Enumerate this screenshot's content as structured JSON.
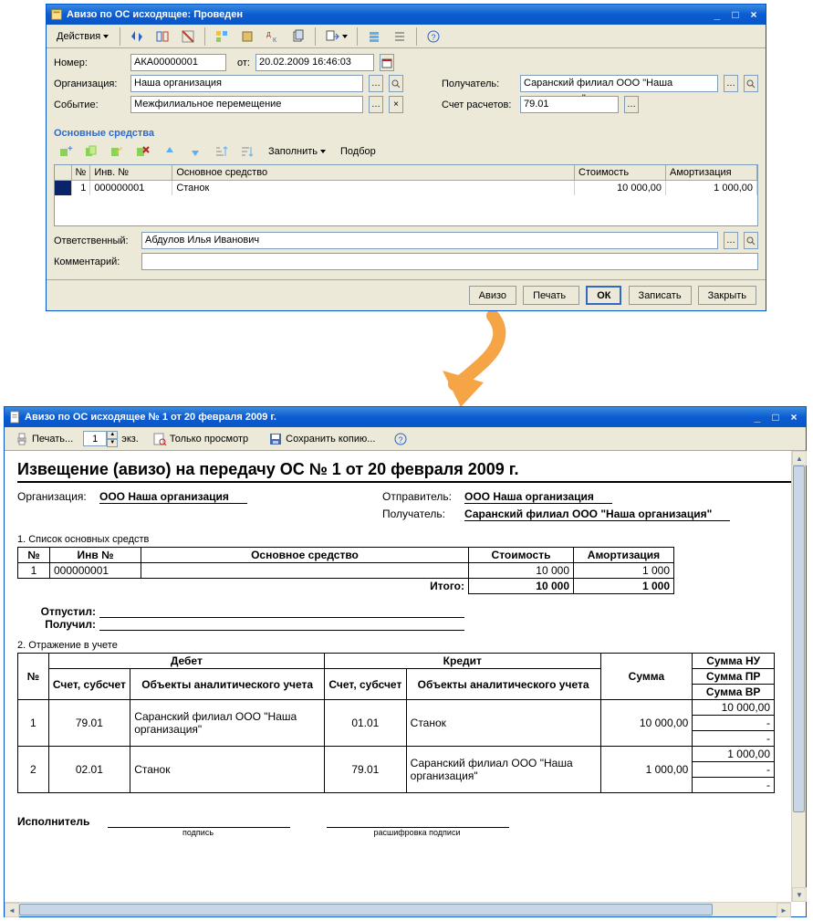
{
  "window1": {
    "title": "Авизо по ОС исходящее: Проведен",
    "toolbar": {
      "actions_label": "Действия"
    },
    "form": {
      "number_label": "Номер:",
      "number_value": "АКА00000001",
      "from_label": "от:",
      "date_value": "20.02.2009 16:46:03",
      "org_label": "Организация:",
      "org_value": "Наша организация",
      "event_label": "Событие:",
      "event_value": "Межфилиальное перемещение",
      "recipient_label": "Получатель:",
      "recipient_value": "Саранский филиал ООО \"Наша организация\"",
      "account_label": "Счет расчетов:",
      "account_value": "79.01"
    },
    "section_title": "Основные средства",
    "subtoolbar": {
      "fill": "Заполнить",
      "pick": "Подбор"
    },
    "grid": {
      "headers": {
        "n": "№",
        "inv": "Инв. №",
        "asset": "Основное средство",
        "cost": "Стоимость",
        "amort": "Амортизация"
      },
      "row": {
        "n": "1",
        "inv": "000000001",
        "asset": "Станок",
        "cost": "10 000,00",
        "amort": "1 000,00"
      }
    },
    "resp_label": "Ответственный:",
    "resp_value": "Абдулов Илья Иванович",
    "comment_label": "Комментарий:",
    "bottom": {
      "avizo": "Авизо",
      "print": "Печать",
      "ok": "ОК",
      "save": "Записать",
      "close": "Закрыть"
    }
  },
  "window2": {
    "title": "Авизо по ОС исходящее № 1 от 20 февраля 2009 г.",
    "toolbar": {
      "print": "Печать...",
      "copies": "1",
      "copies_suffix": "экз.",
      "viewonly": "Только просмотр",
      "savecopy": "Сохранить копию..."
    },
    "doc": {
      "title": "Извещение (авизо) на передачу ОС № 1 от 20 февраля 2009 г.",
      "org_label": "Организация:",
      "org_value": "ООО Наша организация",
      "sender_label": "Отправитель:",
      "sender_value": "ООО Наша организация",
      "recipient_label": "Получатель:",
      "recipient_value": "Саранский филиал ООО \"Наша организация\"",
      "section1": "1. Список основных средств",
      "t1": {
        "h_n": "№",
        "h_inv": "Инв №",
        "h_asset": "Основное средство",
        "h_cost": "Стоимость",
        "h_amort": "Амортизация",
        "r_n": "1",
        "r_inv": "000000001",
        "r_cost": "10 000",
        "r_amort": "1 000",
        "total_label": "Итого:",
        "total_cost": "10 000",
        "total_amort": "1 000"
      },
      "otpustil": "Отпустил:",
      "poluchil": "Получил:",
      "section2": "2. Отражение в учете",
      "t2": {
        "h_n": "№",
        "h_debit": "Дебет",
        "h_credit": "Кредит",
        "h_sum": "Сумма",
        "h_sum_nu": "Сумма НУ",
        "h_sum_pr": "Сумма ПР",
        "h_sum_vr": "Сумма ВР",
        "h_acct": "Счет, субсчет",
        "h_analit": "Объекты аналитического учета",
        "r1_n": "1",
        "r1_d_acct": "79.01",
        "r1_d_analit": "Саранский филиал ООО \"Наша организация\"",
        "r1_c_acct": "01.01",
        "r1_c_analit": "Станок",
        "r1_sum": "10 000,00",
        "r1_sum_nu": "10 000,00",
        "r2_n": "2",
        "r2_d_acct": "02.01",
        "r2_d_analit": "Станок",
        "r2_c_acct": "79.01",
        "r2_c_analit": "Саранский филиал ООО \"Наша организация\"",
        "r2_sum": "1 000,00",
        "r2_sum_nu": "1 000,00",
        "dash": "-"
      },
      "executor": "Исполнитель",
      "sig_sub1": "подпись",
      "sig_sub2": "расшифровка подписи"
    }
  }
}
